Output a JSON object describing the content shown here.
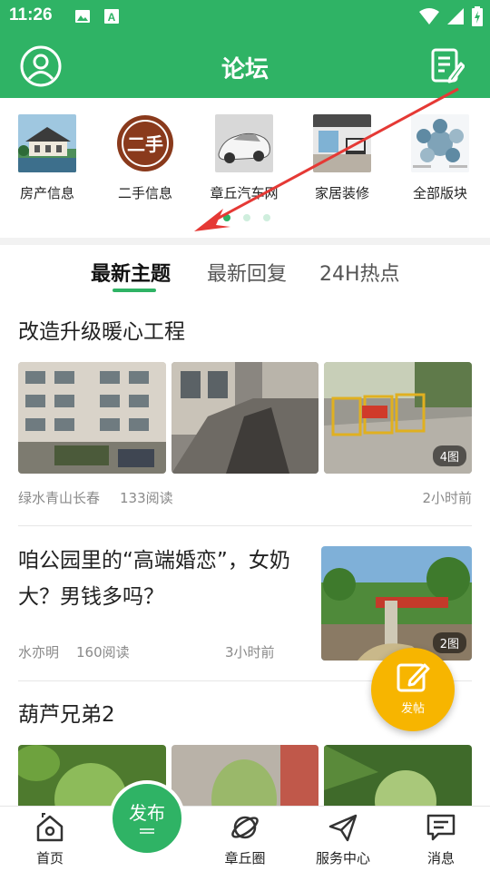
{
  "status_bar": {
    "time": "11:26"
  },
  "header": {
    "title": "论坛"
  },
  "categories": [
    {
      "label": "房产信息"
    },
    {
      "label": "二手信息",
      "badge_text": "二手"
    },
    {
      "label": "章丘汽车网"
    },
    {
      "label": "家居装修"
    },
    {
      "label": "全部版块"
    }
  ],
  "tabs": [
    {
      "label": "最新主题",
      "active": true
    },
    {
      "label": "最新回复"
    },
    {
      "label": "24H热点"
    }
  ],
  "posts": [
    {
      "title": "改造升级暖心工程",
      "author": "绿水青山长春",
      "reads": "133阅读",
      "time": "2小时前",
      "image_count": "4图"
    },
    {
      "title": "咱公园里的“高端婚恋”，女奶大？男钱多吗？",
      "author": "水亦明",
      "reads": "160阅读",
      "time": "3小时前",
      "image_count": "2图"
    },
    {
      "title": "葫芦兄弟2"
    }
  ],
  "fab": {
    "label": "发帖"
  },
  "bottom_nav": {
    "publish_label": "发布",
    "items": [
      {
        "label": "首页"
      },
      {
        "label": "章丘圈"
      },
      {
        "label": "服务中心"
      },
      {
        "label": "消息"
      }
    ]
  },
  "colors": {
    "brand_green": "#2fb365",
    "fab_orange": "#f7b500",
    "arrow_red": "#e53935"
  }
}
